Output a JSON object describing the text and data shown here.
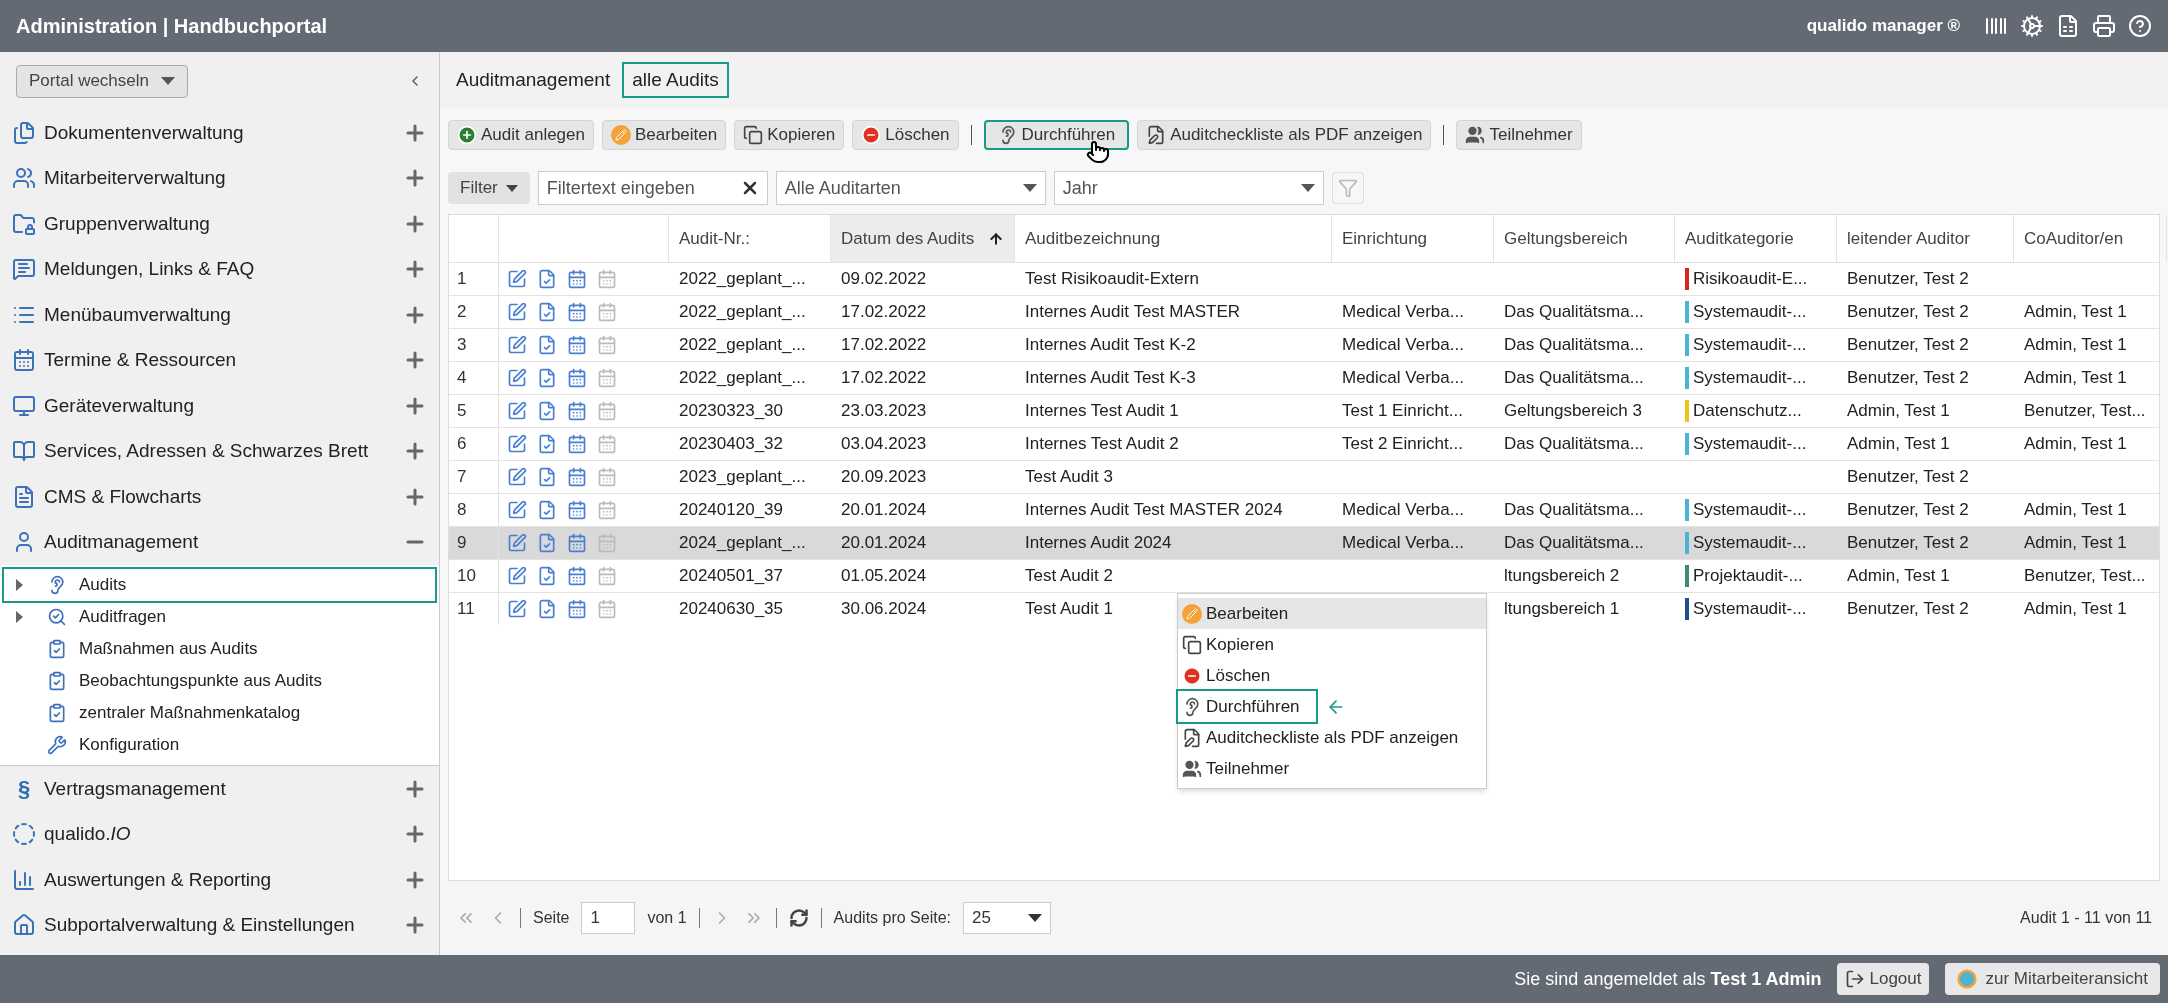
{
  "header": {
    "title": "Administration | Handbuchportal",
    "brand": "qualido manager ®"
  },
  "sidebar": {
    "portal_button": "Portal wechseln",
    "items": [
      {
        "label": "Dokumentenverwaltung",
        "expanded": false
      },
      {
        "label": "Mitarbeiterverwaltung",
        "expanded": false
      },
      {
        "label": "Gruppenverwaltung",
        "expanded": false
      },
      {
        "label": "Meldungen, Links & FAQ",
        "expanded": false
      },
      {
        "label": "Menübaumverwaltung",
        "expanded": false
      },
      {
        "label": "Termine & Ressourcen",
        "expanded": false
      },
      {
        "label": "Geräteverwaltung",
        "expanded": false
      },
      {
        "label": "Services, Adressen & Schwarzes Brett",
        "expanded": false
      },
      {
        "label": "CMS & Flowcharts",
        "expanded": false
      },
      {
        "label": "Auditmanagement",
        "expanded": true,
        "children": [
          {
            "label": "Audits",
            "selected": true,
            "expandable": true
          },
          {
            "label": "Auditfragen",
            "selected": false,
            "expandable": true
          },
          {
            "label": "Maßnahmen aus Audits",
            "selected": false,
            "expandable": false
          },
          {
            "label": "Beobachtungspunkte aus Audits",
            "selected": false,
            "expandable": false
          },
          {
            "label": "zentraler Maßnahmenkatalog",
            "selected": false,
            "expandable": false
          },
          {
            "label": "Konfiguration",
            "selected": false,
            "expandable": false
          }
        ]
      },
      {
        "label": "Vertragsmanagement",
        "expanded": false,
        "icon_text": "§"
      },
      {
        "label": "qualido.*IO*",
        "expanded": false
      },
      {
        "label": "Auswertungen & Reporting",
        "expanded": false
      },
      {
        "label": "Subportalverwaltung & Einstellungen",
        "expanded": false
      }
    ]
  },
  "breadcrumb": {
    "section": "Auditmanagement",
    "view": "alle Audits"
  },
  "toolbar": [
    {
      "label": "Audit anlegen",
      "highlighted": false,
      "separator_before": false
    },
    {
      "label": "Bearbeiten",
      "highlighted": false,
      "separator_before": false
    },
    {
      "label": "Kopieren",
      "highlighted": false,
      "separator_before": false
    },
    {
      "label": "Löschen",
      "highlighted": false,
      "separator_before": false
    },
    {
      "label": "Durchführen",
      "highlighted": true,
      "separator_before": true
    },
    {
      "label": "Auditcheckliste als PDF anzeigen",
      "highlighted": false,
      "separator_before": false
    },
    {
      "label": "Teilnehmer",
      "highlighted": false,
      "separator_before": true
    }
  ],
  "filter": {
    "button": "Filter",
    "placeholder": "Filtertext eingeben",
    "type_select": "Alle Auditarten",
    "year_select": "Jahr"
  },
  "table": {
    "columns": [
      {
        "label": "Audit-Nr.:",
        "sorted": false
      },
      {
        "label": "Datum des Audits",
        "sorted": true
      },
      {
        "label": "Auditbezeichnung",
        "sorted": false
      },
      {
        "label": "Einrichtung",
        "sorted": false
      },
      {
        "label": "Geltungsbereich",
        "sorted": false
      },
      {
        "label": "Auditkategorie",
        "sorted": false
      },
      {
        "label": "leitender Auditor",
        "sorted": false
      },
      {
        "label": "CoAuditor/en",
        "sorted": false
      }
    ],
    "rows": [
      {
        "num": "1",
        "nr": "2022_geplant_...",
        "date": "09.02.2022",
        "name": "Test Risikoaudit-Extern",
        "category": "Risikoaudit-E...",
        "color": "#d9261c",
        "lead": "Benutzer, Test 2",
        "selected": false
      },
      {
        "num": "2",
        "nr": "2022_geplant_...",
        "date": "17.02.2022",
        "name": "Internes Audit Test MASTER",
        "facility": "Medical Verba...",
        "scope": "Das Qualitätsma...",
        "category": "Systemaudit-...",
        "color": "#4bb3d3",
        "lead": "Benutzer, Test 2",
        "co": "Admin, Test 1",
        "selected": false
      },
      {
        "num": "3",
        "nr": "2022_geplant_...",
        "date": "17.02.2022",
        "name": "Internes Audit Test K-2",
        "facility": "Medical Verba...",
        "scope": "Das Qualitätsma...",
        "category": "Systemaudit-...",
        "color": "#4bb3d3",
        "lead": "Benutzer, Test 2",
        "co": "Admin, Test 1",
        "selected": false
      },
      {
        "num": "4",
        "nr": "2022_geplant_...",
        "date": "17.02.2022",
        "name": "Internes Audit Test K-3",
        "facility": "Medical Verba...",
        "scope": "Das Qualitätsma...",
        "category": "Systemaudit-...",
        "color": "#4bb3d3",
        "lead": "Benutzer, Test 2",
        "co": "Admin, Test 1",
        "selected": false
      },
      {
        "num": "5",
        "nr": "20230323_30",
        "date": "23.03.2023",
        "name": "Internes Test Audit 1",
        "facility": "Test 1 Einricht...",
        "scope": "Geltungsbereich 3",
        "category": "Datenschutz...",
        "color": "#f2c31c",
        "lead": "Admin, Test 1",
        "co": "Benutzer, Test...",
        "selected": false
      },
      {
        "num": "6",
        "nr": "20230403_32",
        "date": "03.04.2023",
        "name": "Internes Test Audit 2",
        "facility": "Test 2 Einricht...",
        "scope": "Das Qualitätsma...",
        "category": "Systemaudit-...",
        "color": "#4bb3d3",
        "lead": "Admin, Test 1",
        "co": "Admin, Test 1",
        "selected": false
      },
      {
        "num": "7",
        "nr": "2023_geplant_...",
        "date": "20.09.2023",
        "name": "Test Audit 3",
        "lead": "Benutzer, Test 2",
        "selected": false
      },
      {
        "num": "8",
        "nr": "20240120_39",
        "date": "20.01.2024",
        "name": "Internes Audit Test MASTER 2024",
        "facility": "Medical Verba...",
        "scope": "Das Qualitätsma...",
        "category": "Systemaudit-...",
        "color": "#4bb3d3",
        "lead": "Benutzer, Test 2",
        "co": "Admin, Test 1",
        "selected": false
      },
      {
        "num": "9",
        "nr": "2024_geplant_...",
        "date": "20.01.2024",
        "name": "Internes Audit 2024",
        "facility": "Medical Verba...",
        "scope": "Das Qualitätsma...",
        "category": "Systemaudit-...",
        "color": "#4bb3d3",
        "lead": "Benutzer, Test 2",
        "co": "Admin, Test 1",
        "selected": true
      },
      {
        "num": "10",
        "nr": "20240501_37",
        "date": "01.05.2024",
        "name": "Test Audit 2",
        "scope": "ltungsbereich 2",
        "category": "Projektaudit-...",
        "color": "#3d8a7c",
        "lead": "Admin, Test 1",
        "co": "Benutzer, Test...",
        "selected": false
      },
      {
        "num": "11",
        "nr": "20240630_35",
        "date": "30.06.2024",
        "name": "Test Audit 1",
        "scope": "ltungsbereich 1",
        "category": "Systemaudit-...",
        "color": "#1f4f8a",
        "lead": "Benutzer, Test 2",
        "co": "Admin, Test 1",
        "selected": false
      }
    ]
  },
  "context_menu": [
    {
      "label": "Bearbeiten",
      "hovered": true,
      "marked": false
    },
    {
      "label": "Kopieren",
      "hovered": false,
      "marked": false
    },
    {
      "label": "Löschen",
      "hovered": false,
      "marked": false
    },
    {
      "label": "Durchführen",
      "hovered": false,
      "marked": true
    },
    {
      "label": "Auditcheckliste als PDF anzeigen",
      "hovered": false,
      "marked": false
    },
    {
      "label": "Teilnehmer",
      "hovered": false,
      "marked": false
    }
  ],
  "pagination": {
    "page_label": "Seite",
    "page": "1",
    "of": "von 1",
    "per_page_label": "Audits pro Seite:",
    "per_page": "25",
    "summary": "Audit 1 - 11 von 11"
  },
  "footer": {
    "login": "Sie sind angemeldet als **Test 1 Admin**",
    "logout": "Logout",
    "switch": "zur Mitarbeiteransicht"
  }
}
